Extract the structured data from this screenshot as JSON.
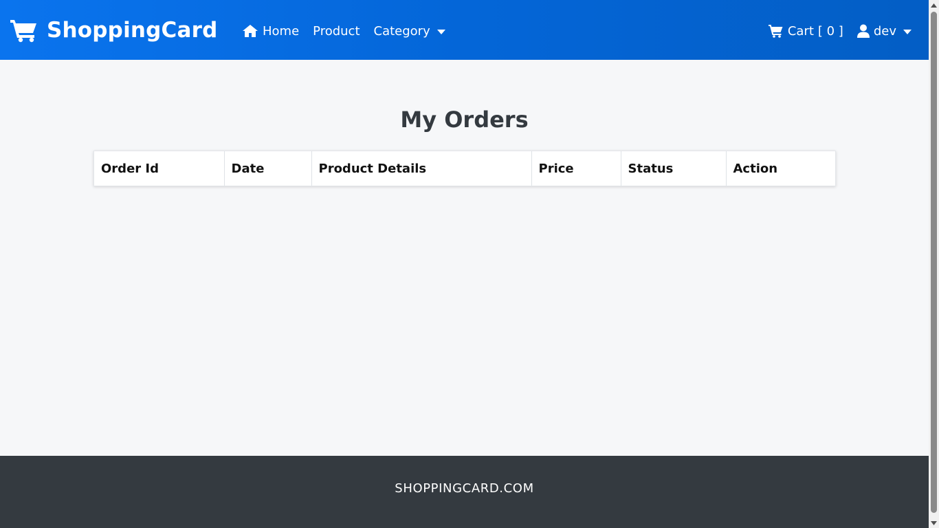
{
  "navbar": {
    "brand": "ShoppingCard",
    "links": [
      {
        "label": "Home",
        "icon": "home-icon"
      },
      {
        "label": "Product"
      },
      {
        "label": "Category",
        "dropdown": true
      }
    ],
    "cart": {
      "label": "Cart",
      "count": "[ 0 ]",
      "icon": "cart-icon"
    },
    "user": {
      "label": "dev",
      "icon": "user-icon",
      "dropdown": true
    }
  },
  "main": {
    "title": "My Orders",
    "table": {
      "columns": [
        "Order Id",
        "Date",
        "Product Details",
        "Price",
        "Status",
        "Action"
      ],
      "rows": []
    }
  },
  "footer": {
    "text": "SHOPPINGCARD.COM"
  },
  "colors": {
    "navbar": "#0466d8",
    "page_bg": "#f6f7f9",
    "footer_bg": "#343a40"
  }
}
